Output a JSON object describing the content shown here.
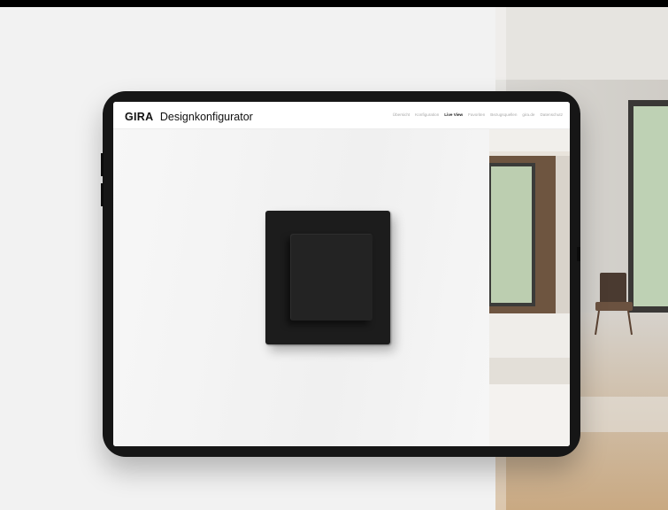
{
  "app": {
    "logo": "GIRA",
    "title": "Designkonfigurator"
  },
  "nav": {
    "items": [
      {
        "label": "Übersicht",
        "active": false
      },
      {
        "label": "Konfiguration",
        "active": false
      },
      {
        "label": "Live View",
        "active": true
      },
      {
        "label": "Favoriten",
        "active": false
      },
      {
        "label": "Bezugsquellen",
        "active": false
      },
      {
        "label": "gira.de",
        "active": false
      },
      {
        "label": "Datenschutz",
        "active": false
      }
    ]
  },
  "product": {
    "icon": "light-switch-icon",
    "frame_color": "#1c1c1c",
    "rocker_color": "#232323"
  },
  "colors": {
    "background": "#f2f2f2",
    "tablet_bezel": "#161616",
    "nav_active": "#222222",
    "nav_inactive": "#a8a8a8"
  }
}
